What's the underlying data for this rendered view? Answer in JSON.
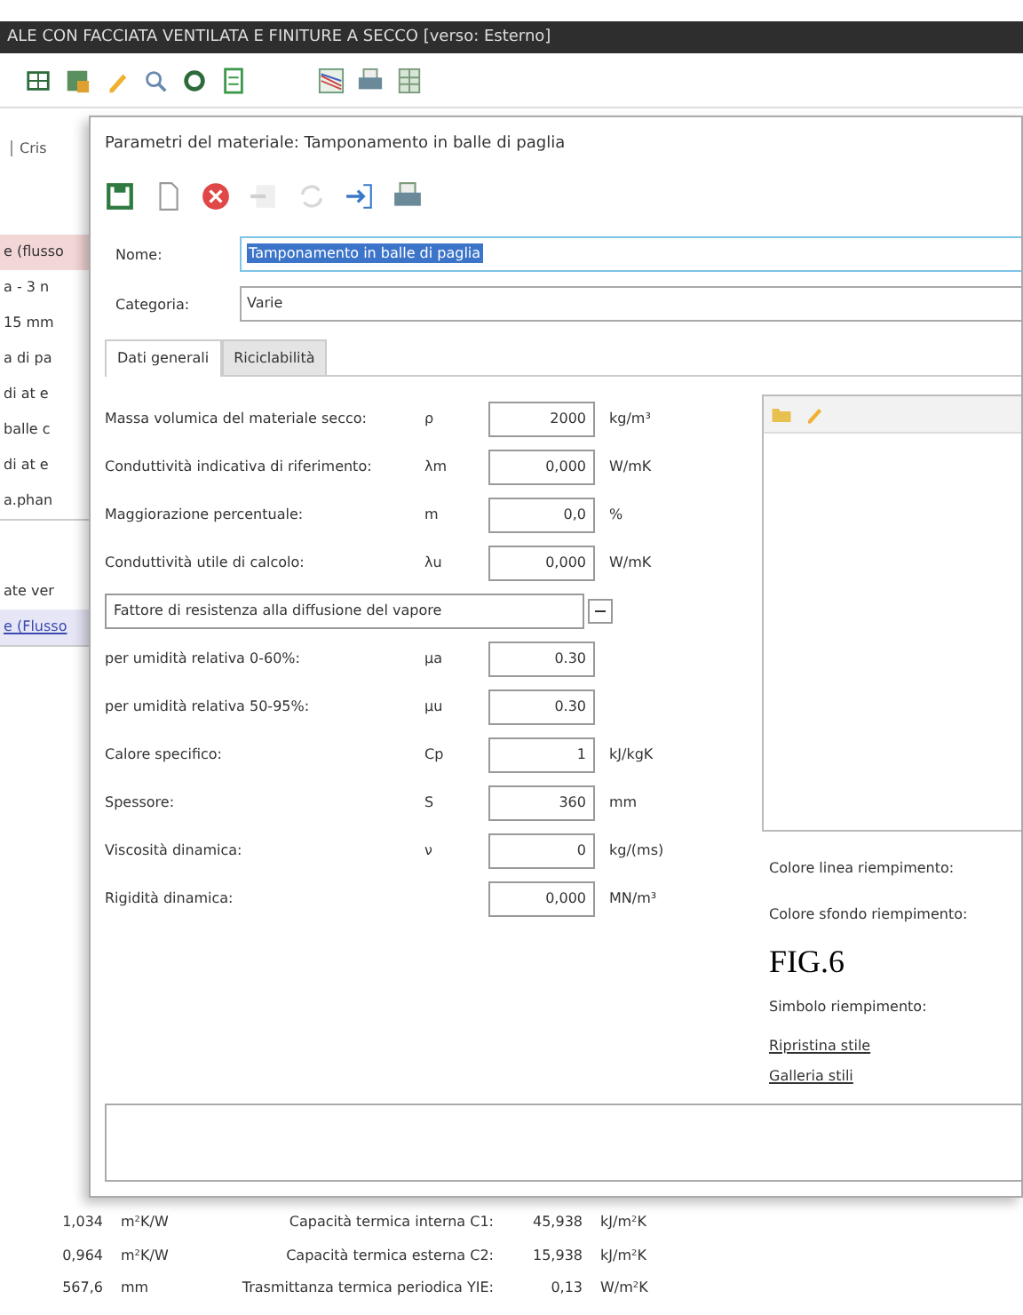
{
  "window": {
    "title": "ALE CON FACCIATA VENTILATA E FINITURE A SECCO [verso: Esterno]"
  },
  "toolbar": {
    "groups": [
      [
        {
          "kind": "grid"
        },
        {
          "kind": "table"
        },
        {
          "kind": "pencil"
        },
        {
          "kind": "search"
        },
        {
          "kind": "gear"
        },
        {
          "kind": "sheet"
        }
      ],
      [
        {
          "kind": "chart"
        },
        {
          "kind": "printer"
        },
        {
          "kind": "columns"
        }
      ]
    ]
  },
  "background_panel": {
    "tab": "Cris",
    "groups": [
      [
        {
          "text": "e (flusso",
          "kind": "highlight"
        },
        {
          "text": "a - 3 n",
          "kind": "plain"
        },
        {
          "text": "15 mm",
          "kind": "plain"
        },
        {
          "text": "a di pa",
          "kind": "plain"
        },
        {
          "text": "di at e",
          "kind": "plain"
        },
        {
          "text": "balle c",
          "kind": "plain"
        },
        {
          "text": "di at e",
          "kind": "plain"
        },
        {
          "text": "a.phan",
          "kind": "plain"
        }
      ],
      [
        {
          "text": "ate ver",
          "kind": "plain"
        },
        {
          "text": "e (Flusso",
          "kind": "link"
        }
      ]
    ]
  },
  "dialog": {
    "title": "Parametri del materiale: Tamponamento in balle di paglia",
    "toolbar": [
      {
        "kind": "save",
        "disabled": false
      },
      {
        "kind": "new",
        "disabled": false
      },
      {
        "kind": "delete",
        "disabled": false
      },
      {
        "kind": "import",
        "disabled": true
      },
      {
        "kind": "refresh",
        "disabled": true
      },
      {
        "kind": "export",
        "disabled": false
      },
      {
        "kind": "printer",
        "disabled": false
      }
    ],
    "name": {
      "label": "Nome:",
      "value": "Tamponamento in balle di paglia",
      "selected": true
    },
    "category": {
      "label": "Categoria:",
      "value": "Varie"
    },
    "tabs": [
      {
        "label": "Dati generali",
        "selected": true
      },
      {
        "label": "Riciclabilità",
        "selected": false
      }
    ],
    "rows": [
      {
        "kind": "field",
        "label": "Massa volumica del materiale secco:",
        "symbol": "ρ",
        "value": "2000",
        "unit": "kg/m³"
      },
      {
        "kind": "field",
        "label": "Conduttività indicativa di riferimento:",
        "symbol": "λm",
        "value": "0,000",
        "unit": "W/mK"
      },
      {
        "kind": "field",
        "label": "Maggiorazione percentuale:",
        "symbol": "m",
        "value": "0,0",
        "unit": "%"
      },
      {
        "kind": "field",
        "label": "Conduttività utile di calcolo:",
        "symbol": "λu",
        "value": "0,000",
        "unit": "W/mK"
      },
      {
        "kind": "dropdown",
        "value": "Fattore di resistenza alla diffusione del vapore"
      },
      {
        "kind": "field",
        "label": "per umidità relativa 0-60%:",
        "symbol": "μa",
        "value": "0.30"
      },
      {
        "kind": "field",
        "label": "per umidità relativa 50-95%:",
        "symbol": "μu",
        "value": "0.30"
      },
      {
        "kind": "field",
        "label": "Calore specifico:",
        "symbol": "Cp",
        "value": "1",
        "unit": "kJ/kgK"
      },
      {
        "kind": "field",
        "label": "Spessore:",
        "symbol": "S",
        "value": "360",
        "unit": "mm"
      },
      {
        "kind": "field",
        "label": "Viscosità dinamica:",
        "symbol": "ν",
        "value": "0",
        "unit": "kg/(ms)"
      },
      {
        "kind": "field",
        "label": "Rigidità dinamica:",
        "value": "0,000",
        "unit": "MN/m³"
      }
    ],
    "image_panel": {
      "tools": [
        {
          "kind": "folder"
        },
        {
          "kind": "pencil"
        }
      ]
    },
    "fill_settings": [
      {
        "kind": "label",
        "text": "Colore linea riempimento:"
      },
      {
        "kind": "label",
        "text": "Colore sfondo riempimento:"
      },
      {
        "kind": "caption",
        "text": "FIG.6"
      },
      {
        "kind": "label",
        "text": "Simbolo riempimento:"
      },
      {
        "kind": "link",
        "text": "Ripristina stile"
      },
      {
        "kind": "link",
        "text": "Galleria stili"
      }
    ]
  },
  "results": [
    {
      "value": "1,034",
      "unit": "m²K/W",
      "label": "Capacità termica interna C1:",
      "value_2": "45,938",
      "unit_2": "kJ/m²K"
    },
    {
      "value": "0,964",
      "unit": "m²K/W",
      "label": "Capacità termica esterna C2:",
      "value_2": "15,938",
      "unit_2": "kJ/m²K"
    },
    {
      "value": "567,6",
      "unit": "mm",
      "label": "Trasmittanza termica periodica YIE:",
      "value_2": "0,13",
      "unit_2": "W/m²K"
    }
  ]
}
